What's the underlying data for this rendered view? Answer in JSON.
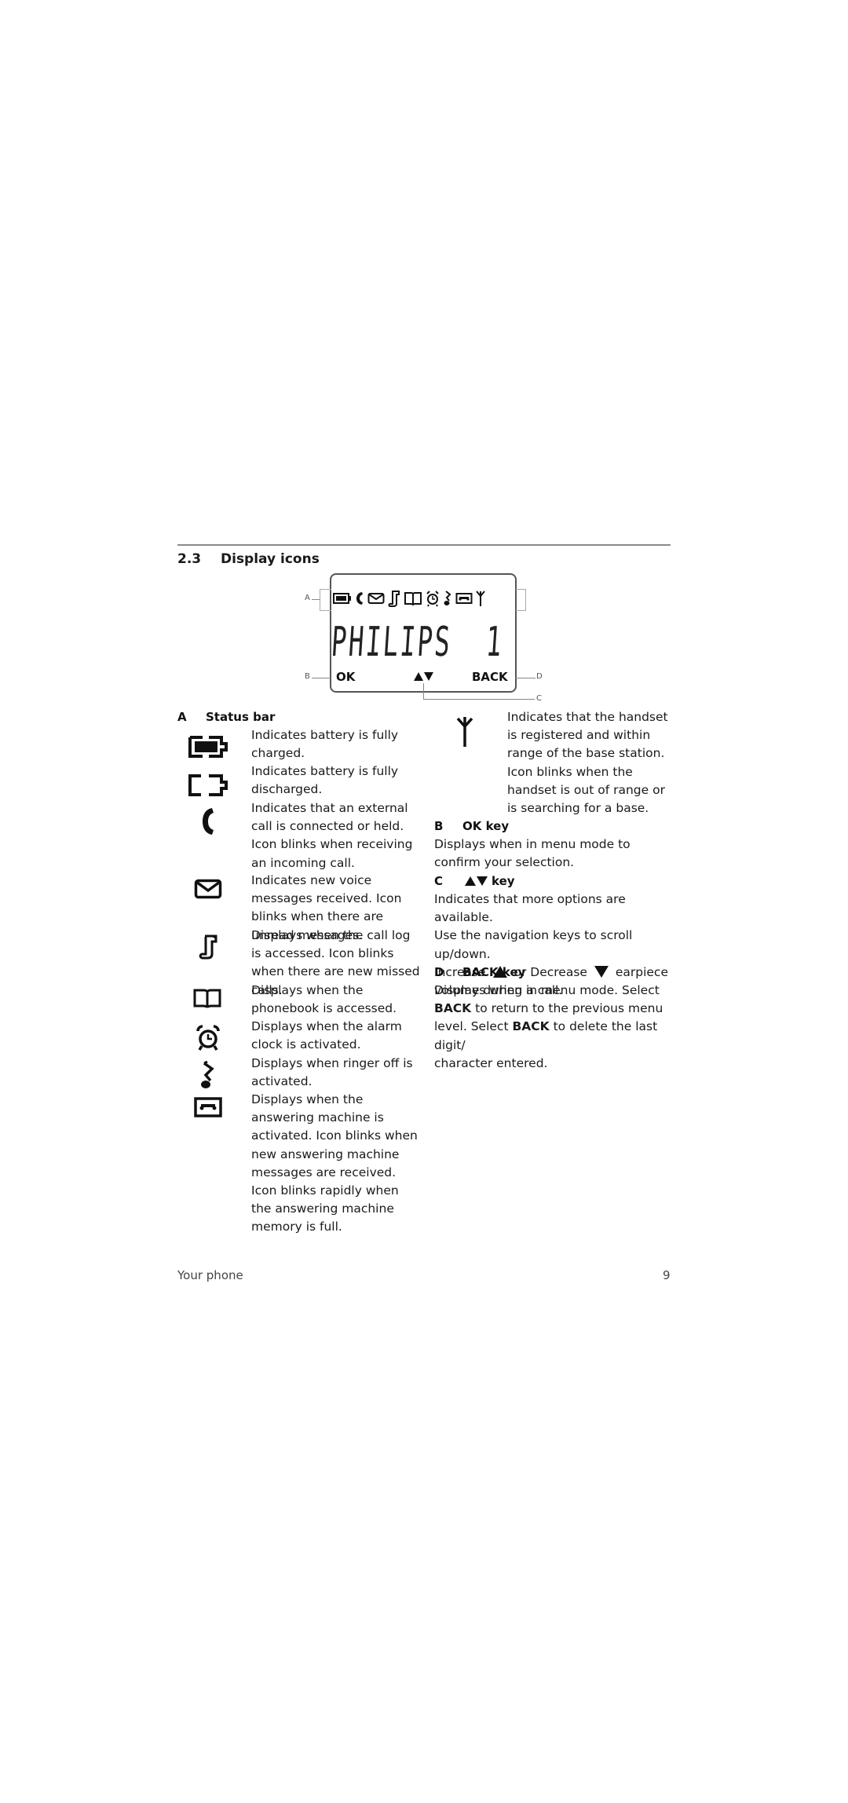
{
  "section": {
    "number": "2.3",
    "title": "Display icons"
  },
  "diagram": {
    "lcd_text": "PHILIPS  1",
    "ok_label": "OK",
    "back_label": "BACK",
    "callouts": {
      "a": "A",
      "b": "B",
      "c": "C",
      "d": "D"
    },
    "status_icons": [
      "battery-full-icon",
      "phone-handset-icon",
      "envelope-icon",
      "call-log-icon",
      "book-icon",
      "alarm-clock-icon",
      "ringer-off-icon",
      "tape-icon",
      "antenna-icon"
    ]
  },
  "status_bar": {
    "letter": "A",
    "title": "Status bar",
    "items": [
      {
        "icon": "battery-full-icon",
        "text": "Indicates battery is fully charged."
      },
      {
        "icon": "battery-empty-icon",
        "text": "Indicates battery is fully discharged."
      },
      {
        "icon": "phone-handset-icon",
        "text": "Indicates that an external call is connected or held. Icon blinks when receiving an incoming call."
      },
      {
        "icon": "envelope-icon",
        "text": "Indicates new voice messages received. Icon blinks when there are unread messages."
      },
      {
        "icon": "call-log-icon",
        "text": "Displays when the call log is accessed. Icon blinks when there are new missed calls."
      },
      {
        "icon": "book-icon",
        "text": "Displays when the phonebook is accessed."
      },
      {
        "icon": "alarm-clock-icon",
        "text": "Displays when the alarm clock is activated."
      },
      {
        "icon": "ringer-off-icon",
        "text": "Displays when ringer off is activated."
      },
      {
        "icon": "tape-icon",
        "text": "Displays when the answering machine is activated. Icon blinks when new answering machine messages are received. Icon blinks rapidly when the answering machine memory is full."
      },
      {
        "icon": "antenna-icon",
        "text": "Indicates that the handset is registered and within range of the base station. Icon blinks when the handset is out of range or is searching for a base."
      }
    ]
  },
  "ok_key": {
    "letter": "B",
    "title": "OK key",
    "text": "Displays when in menu mode to confirm your selection."
  },
  "nav_key": {
    "letter": "C",
    "title": "key",
    "line1": "Indicates that more options are available.",
    "line2": "Use the navigation keys to scroll up/down.",
    "line3_a": "Increase",
    "line3_b": "or Decrease",
    "line3_c": "earpiece",
    "line4": "volume during a call."
  },
  "back_key": {
    "letter": "D",
    "title": "BACK key",
    "p1": "Displays when in menu mode. Select",
    "bold": "BACK",
    "p2": "to return to the previous menu",
    "p3": "level. Select",
    "p4": "to delete the last digit/",
    "p5": "character entered."
  },
  "footer": {
    "left": "Your phone",
    "page": "9"
  }
}
